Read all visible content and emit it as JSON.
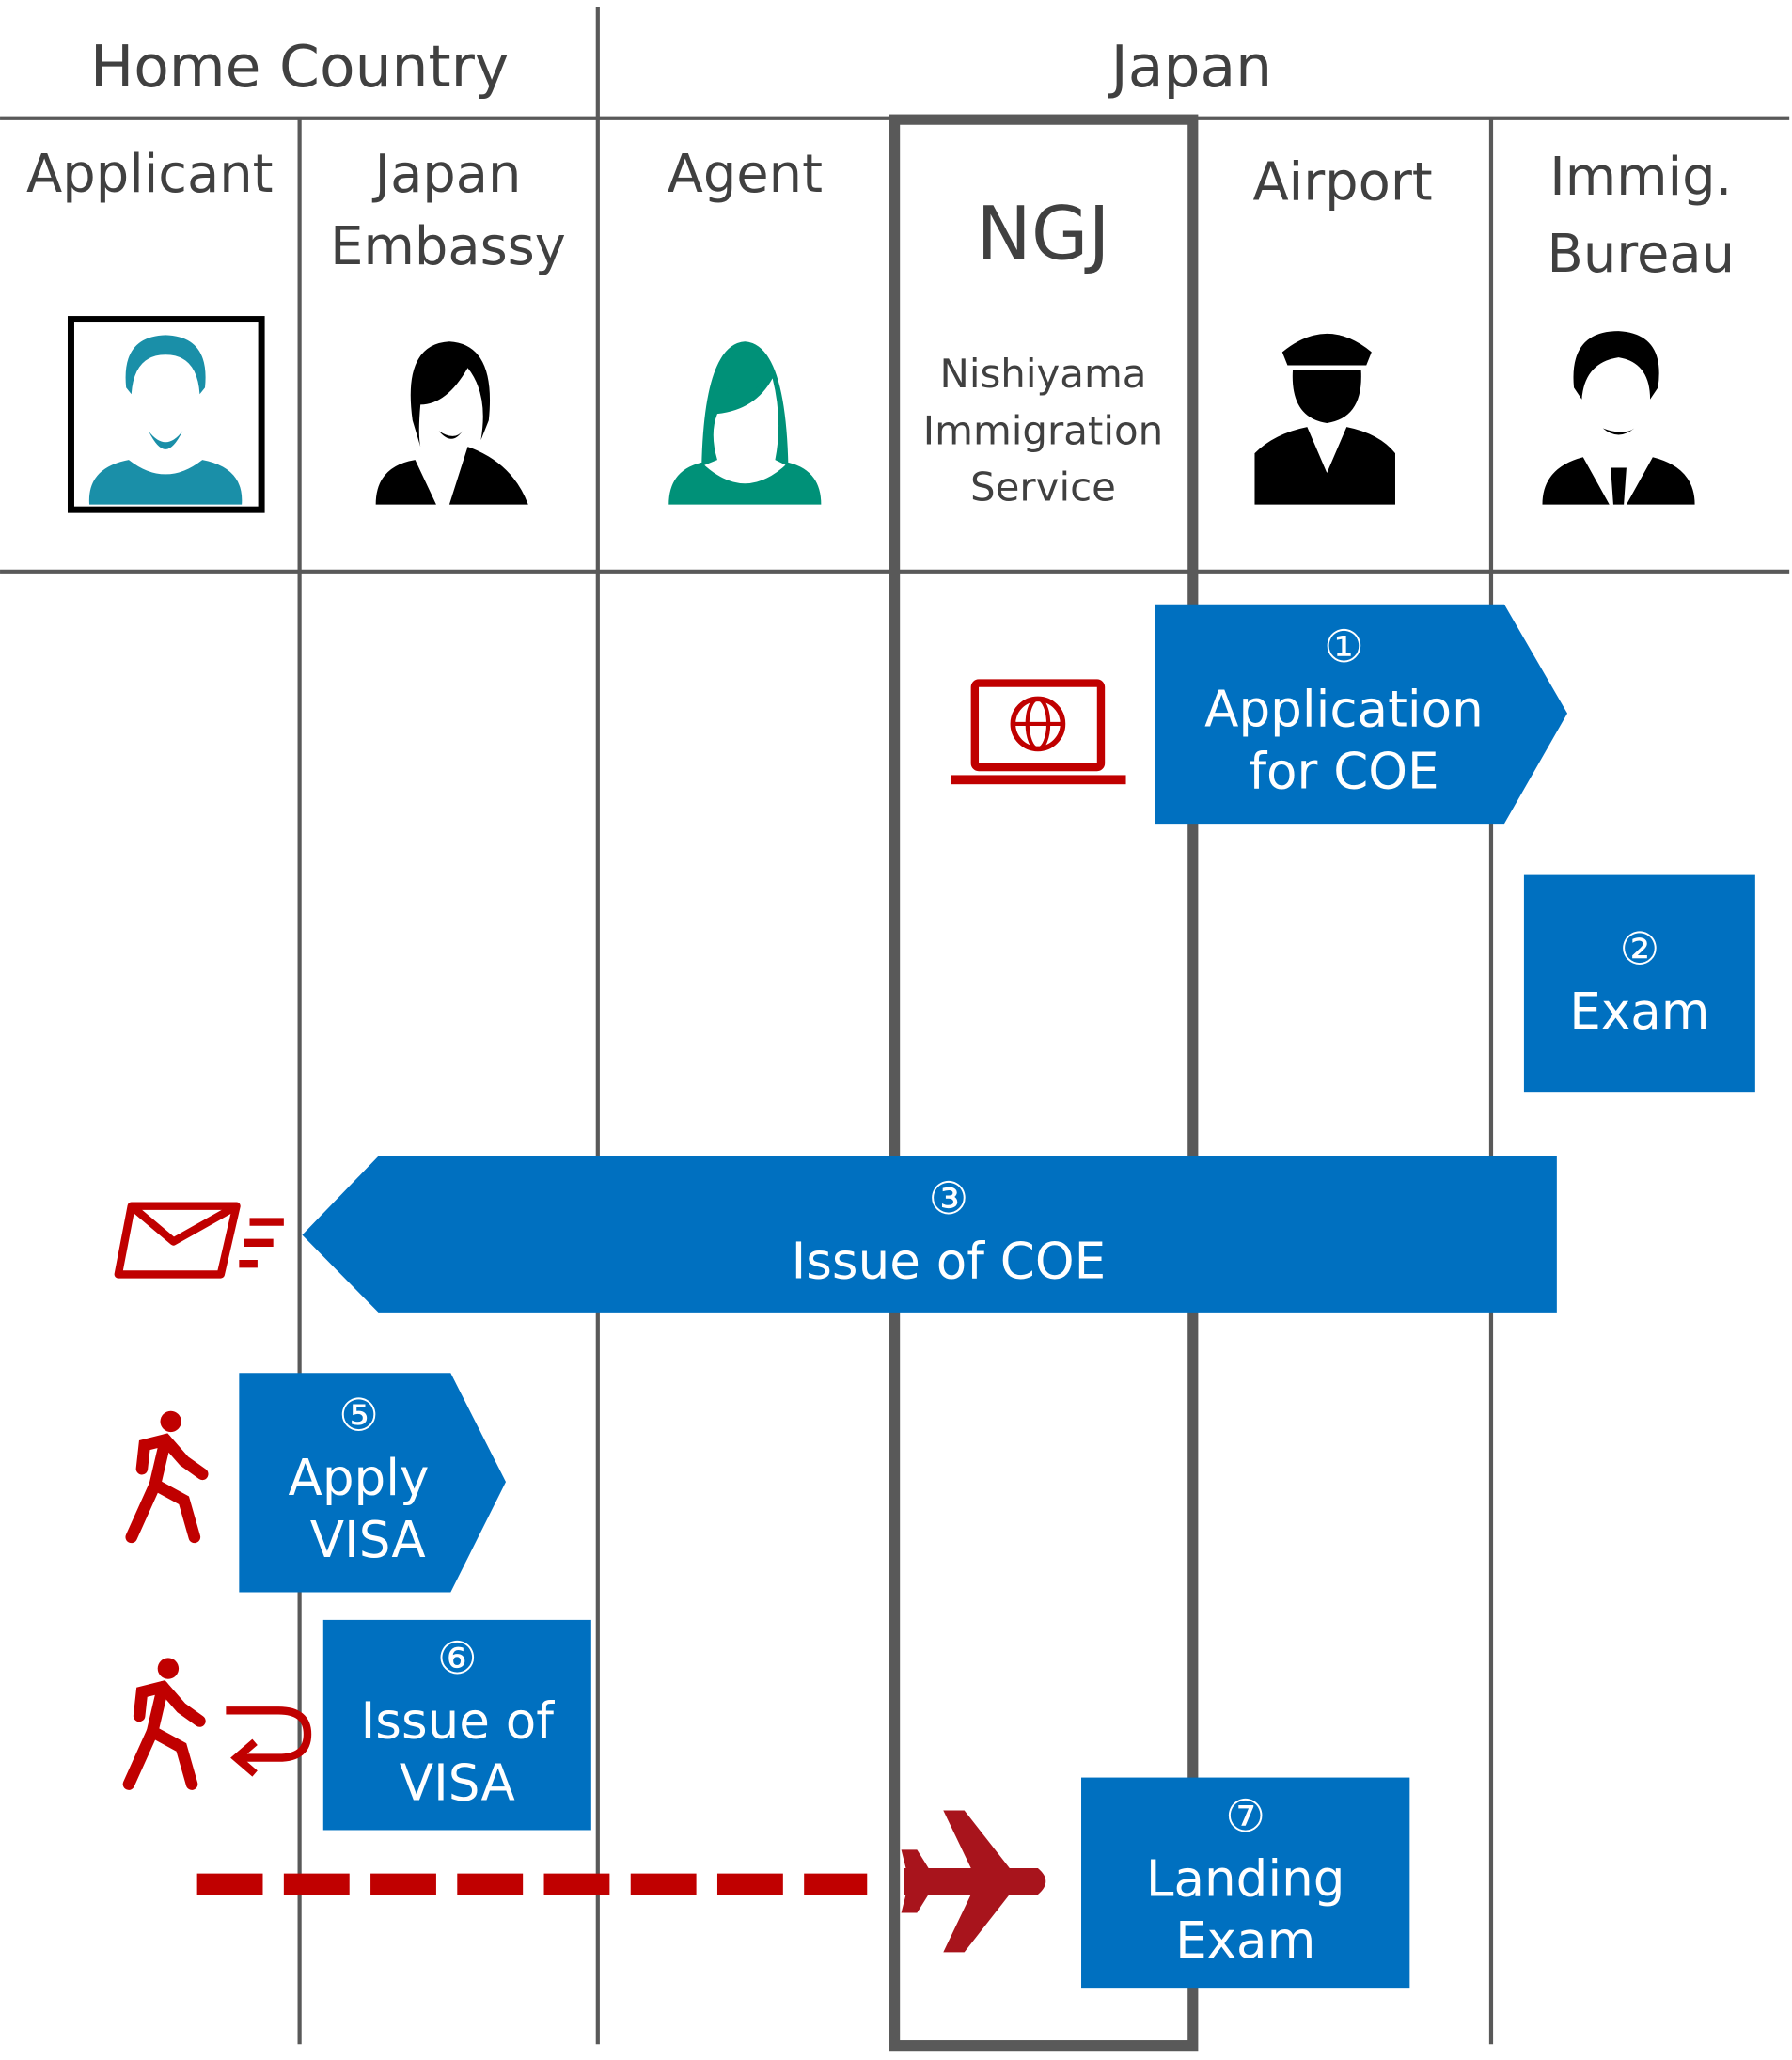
{
  "regions": {
    "home": "Home Country",
    "japan": "Japan"
  },
  "columns": {
    "applicant": "Applicant",
    "embassy": [
      "Japan",
      "Embassy"
    ],
    "agent": "Agent",
    "ngj": {
      "title": "NGJ",
      "subtitle": [
        "Nishiyama",
        "Immigration",
        "Service"
      ]
    },
    "airport": "Airport",
    "bureau": [
      "Immig.",
      "Bureau"
    ]
  },
  "steps": [
    {
      "num": "①",
      "lines": [
        "Application",
        "for COE"
      ]
    },
    {
      "num": "②",
      "lines": [
        "Exam"
      ]
    },
    {
      "num": "③",
      "lines": [
        "Issue of COE"
      ]
    },
    {
      "num": "⑤",
      "lines": [
        "Apply",
        "VISA"
      ]
    },
    {
      "num": "⑥",
      "lines": [
        "Issue of",
        "VISA"
      ]
    },
    {
      "num": "⑦",
      "lines": [
        "Landing",
        "Exam"
      ]
    }
  ],
  "colors": {
    "step_blue": "#0070C0",
    "icon_red": "#C00000",
    "line_gray": "#595959",
    "applicant_teal": "#1A8FA8",
    "agent_green": "#009178"
  },
  "icons": [
    "applicant-avatar-icon",
    "embassy-woman-icon",
    "agent-woman-icon",
    "airport-officer-icon",
    "bureau-man-icon",
    "laptop-globe-icon",
    "mail-icon",
    "walking-person-icon",
    "return-arrow-icon",
    "airplane-icon"
  ]
}
